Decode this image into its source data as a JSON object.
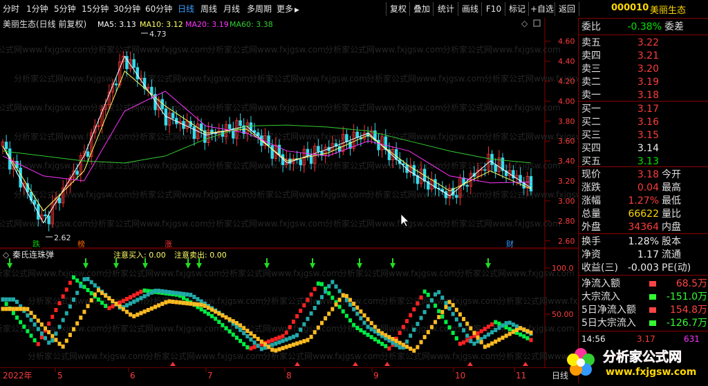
{
  "toolbar": {
    "periods": [
      "分时",
      "1分钟",
      "5分钟",
      "15分钟",
      "30分钟",
      "60分钟",
      "日线",
      "周线",
      "月线",
      "多周期",
      "更多"
    ],
    "active_period": "日线",
    "more_arrow": "▶",
    "tools": [
      "复权",
      "叠加",
      "统计",
      "画线",
      "F10",
      "标记",
      "+自选",
      "返回"
    ],
    "stock_code": "000010",
    "stock_name": "美丽生态"
  },
  "main_chart": {
    "title": "美丽生态(日线 前复权)",
    "legend": [
      {
        "label": "MA5: 3.13",
        "color": "#ffffff"
      },
      {
        "label": "MA10: 3.12",
        "color": "#ffff66"
      },
      {
        "label": "MA20: 3.19",
        "color": "#ff33ff"
      },
      {
        "label": "MA60: 3.38",
        "color": "#33cc33"
      }
    ],
    "high_label": "4.73",
    "low_label": "2.62",
    "y_ticks": [
      "4.60",
      "4.40",
      "4.20",
      "4.00",
      "3.80",
      "3.60",
      "3.40",
      "3.20",
      "3.00",
      "2.80",
      "2.60"
    ],
    "markers": [
      {
        "text": "跌",
        "color": "#00cc00"
      },
      {
        "text": "榜",
        "color": "#ff6600"
      },
      {
        "text": "涨",
        "color": "#ff3333"
      },
      {
        "text": "财",
        "color": "#3399ff"
      }
    ],
    "icons": [
      "diamond-icon",
      "square-icon"
    ],
    "watermark_text": "分析家公式网www.fxjgsw.com"
  },
  "chart_data": [
    {
      "type": "line",
      "title": "",
      "xlabel": "",
      "ylabel": "",
      "ylim": [
        2.55,
        4.75
      ],
      "x": [
        "2022/5",
        "2022/6",
        "2022/7",
        "2022/8",
        "2022/9",
        "2022/10",
        "2022/11"
      ],
      "series": [
        {
          "name": "MA5",
          "color": "#ffffff",
          "values": [
            3.55,
            2.78,
            3.45,
            4.45,
            3.85,
            3.66,
            3.75,
            3.38,
            3.52,
            3.68,
            3.3,
            3.05,
            3.4,
            3.13
          ]
        },
        {
          "name": "MA10",
          "color": "#ffff66",
          "values": [
            3.55,
            2.9,
            3.3,
            4.3,
            3.95,
            3.68,
            3.72,
            3.4,
            3.48,
            3.66,
            3.35,
            3.1,
            3.3,
            3.12
          ]
        },
        {
          "name": "MA20",
          "color": "#ff33ff",
          "values": [
            3.45,
            3.25,
            3.2,
            3.9,
            4.1,
            3.75,
            3.68,
            3.5,
            3.45,
            3.6,
            3.5,
            3.25,
            3.18,
            3.19
          ]
        },
        {
          "name": "MA60",
          "color": "#33cc33",
          "values": [
            3.5,
            3.45,
            3.4,
            3.38,
            3.45,
            3.62,
            3.75,
            3.76,
            3.74,
            3.7,
            3.6,
            3.5,
            3.42,
            3.38
          ]
        }
      ]
    },
    {
      "type": "line",
      "title": "秦氏连珠弹",
      "ylim": [
        0,
        105
      ],
      "y_ticks": [
        "100.0",
        "50.00"
      ],
      "series": [
        {
          "name": "注意买入",
          "values": [
            70,
            20,
            95,
            60,
            80,
            75,
            50,
            15,
            30,
            90,
            40,
            15,
            80,
            20,
            45,
            25
          ]
        },
        {
          "name": "注意卖出",
          "values": [
            0
          ]
        }
      ]
    }
  ],
  "indicator": {
    "title": "秦氏连珠弹",
    "buy_label": "注意买入: 0.00",
    "sell_label": "注意卖出: 0.00",
    "y_ticks": [
      "100.0",
      "50.00"
    ]
  },
  "x_axis": {
    "labels": [
      "2022年",
      "5",
      "6",
      "7",
      "8",
      "9",
      "10",
      "11"
    ],
    "right_label": "日线"
  },
  "side": {
    "weibi": {
      "label": "委比",
      "value": "-0.38%",
      "right": "委差"
    },
    "sells": [
      {
        "label": "卖五",
        "price": "3.22"
      },
      {
        "label": "卖四",
        "price": "3.21"
      },
      {
        "label": "卖三",
        "price": "3.20"
      },
      {
        "label": "卖二",
        "price": "3.19"
      },
      {
        "label": "卖一",
        "price": "3.18"
      }
    ],
    "buys": [
      {
        "label": "买一",
        "price": "3.17"
      },
      {
        "label": "买二",
        "price": "3.16"
      },
      {
        "label": "买三",
        "price": "3.15"
      },
      {
        "label": "买四",
        "price": "3.14"
      },
      {
        "label": "买五",
        "price": "3.13"
      }
    ],
    "stats": [
      {
        "l1": "现价",
        "v1": "3.18",
        "l2": "今开"
      },
      {
        "l1": "涨跌",
        "v1": "0.04",
        "l2": "最高"
      },
      {
        "l1": "涨幅",
        "v1": "1.27%",
        "l2": "最低"
      },
      {
        "l1": "总量",
        "v1": "66622",
        "l2": "量比"
      },
      {
        "l1": "外盘",
        "v1": "34364",
        "l2": "内盘"
      }
    ],
    "stats2": [
      {
        "l1": "换手",
        "v1": "1.28%",
        "l2": "股本"
      },
      {
        "l1": "净资",
        "v1": "1.17",
        "l2": "流通"
      },
      {
        "l1": "收益(三)",
        "v1": "-0.003",
        "l2": "PE(动)"
      }
    ],
    "flows": [
      {
        "label": "净流入额",
        "value": "68.5万",
        "color": "#ff4444"
      },
      {
        "label": "大宗流入",
        "value": "-151.0万",
        "color": "#33ff33"
      },
      {
        "label": "5日净流入额",
        "value": "154.8万",
        "color": "#ff4444"
      },
      {
        "label": "5日大宗流入",
        "value": "-126.7万",
        "color": "#33ff33"
      }
    ],
    "tick": {
      "time": "14:56",
      "price": "3.17",
      "vol": "631"
    }
  },
  "logo": {
    "text": "分析家公式网",
    "url": "www.fxjgsw.com"
  }
}
